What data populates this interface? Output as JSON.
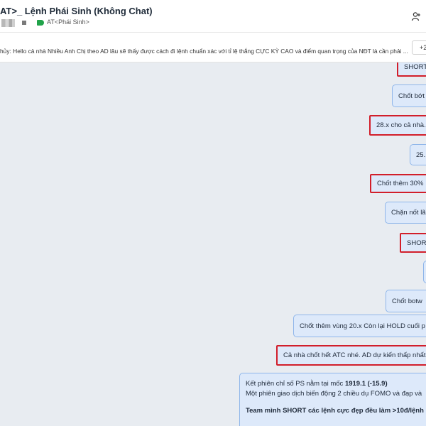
{
  "header": {
    "title": "AT>_ Lệnh Phái Sinh (Không Chat)",
    "tag_label": "AT<Phái Sinh>"
  },
  "pinned": {
    "text": "hủy: Hello cả nhà Nhiều Anh Chị theo AD lâu sẽ thấy được cách đi lệnh chuẩn xác với tỉ lệ thắng CỰC KỲ CAO và điểm quan trọng của NĐT là cần phải ...",
    "button_label": "+2"
  },
  "messages": [
    {
      "text": "SHORT",
      "highlighted": true
    },
    {
      "text": "Chốt bớt",
      "highlighted": false
    },
    {
      "text": "28.x cho cả nhà...",
      "highlighted": true
    },
    {
      "text": "25.",
      "highlighted": false
    },
    {
      "text": "Chốt thêm 30%",
      "highlighted": true
    },
    {
      "text": "Chặn nốt lã",
      "highlighted": false
    },
    {
      "text": "SHORT",
      "highlighted": true
    },
    {
      "text": "",
      "highlighted": false
    },
    {
      "text": "Chốt botw",
      "highlighted": false
    },
    {
      "text": "Chốt thêm vùng 20.x Còn lại HOLD cuối p",
      "highlighted": false
    },
    {
      "text": "Cả nhà chốt hết ATC nhé. AD dự kiến thấp nhất",
      "highlighted": true
    }
  ],
  "summary": {
    "line1_prefix": "Kết phiên chỉ số PS nằm tại mốc ",
    "line1_bold": "1919.1 (-15.9)",
    "line2": "Một phiên giao dịch biến động 2 chiều dụ FOMO và đạp và",
    "line3_bold": "Team mình SHORT các lệnh cực đẹp đều làm >10đ/lệnh !"
  }
}
